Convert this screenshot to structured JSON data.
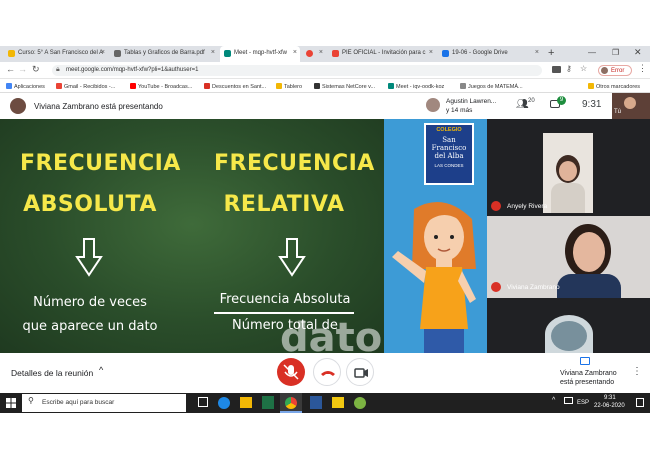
{
  "tabs": [
    {
      "label": "Curso: 5° A San Francisco del A",
      "color": "#f2b705"
    },
    {
      "label": "Tablas y Graficos de Barra.pdf",
      "color": "#666"
    },
    {
      "label": "Meet - mqp-hvtf-xfw",
      "color": "#00897b"
    },
    {
      "label": "",
      "color": "#ea4335"
    },
    {
      "label": "PIE OFICIAL - Invitación para c",
      "color": "#ea4335"
    },
    {
      "label": "19-06 - Google Drive",
      "color": "#1a73e8"
    }
  ],
  "browser": {
    "url": "meet.google.com/mqp-hvtf-xfw?pli=1&authuser=1",
    "error_label": "Error",
    "new_tab": "+"
  },
  "bookmarks": [
    {
      "label": "Aplicaciones",
      "color": "#4285f4"
    },
    {
      "label": "Gmail - Recibidos -...",
      "color": "#ea4335"
    },
    {
      "label": "YouTube - Broadcas...",
      "color": "#ff0000"
    },
    {
      "label": "Descuentos en Sant...",
      "color": "#d93025"
    },
    {
      "label": "Tablero",
      "color": "#f2b705"
    },
    {
      "label": "Sistemas NetCore v...",
      "color": "#333"
    },
    {
      "label": "Meet - iqv-oodk-koz",
      "color": "#00897b"
    },
    {
      "label": "Juegos de MATEMÁ...",
      "color": "#888"
    },
    {
      "label": "Otros marcadores",
      "color": "#f2b705"
    }
  ],
  "meet": {
    "presenter_banner": "Viviana Zambrano está presentando",
    "participants_summary": "Agustin Lawren...",
    "participants_more": "y 14 más",
    "people_count": "20",
    "chat_count": "9",
    "time": "9:31",
    "self_label": "Tú"
  },
  "slide": {
    "left_title_1": "FRECUENCIA",
    "left_title_2": "ABSOLUTA",
    "left_desc_1": "Número de veces",
    "left_desc_2": "que aparece un dato",
    "right_title_1": "FRECUENCIA",
    "right_title_2": "RELATIVA",
    "right_num": "Frecuencia Absoluta",
    "right_den": "Número total de",
    "watermark": "datos",
    "school_1": "COLEGIO",
    "school_2": "San",
    "school_3": "Francisco",
    "school_4": "del Alba",
    "school_5": "LAS CONDES"
  },
  "tiles": [
    {
      "name": "Anyely Rivera"
    },
    {
      "name": "Viviana Zambrano"
    }
  ],
  "bottom": {
    "meeting_details": "Detalles de la reunión",
    "presenting_1": "Viviana Zambrano",
    "presenting_2": "está presentando"
  },
  "taskbar": {
    "search_placeholder": "Escribe aquí para buscar",
    "lang": "ESP",
    "time": "9:31",
    "date": "22-06-2020"
  }
}
